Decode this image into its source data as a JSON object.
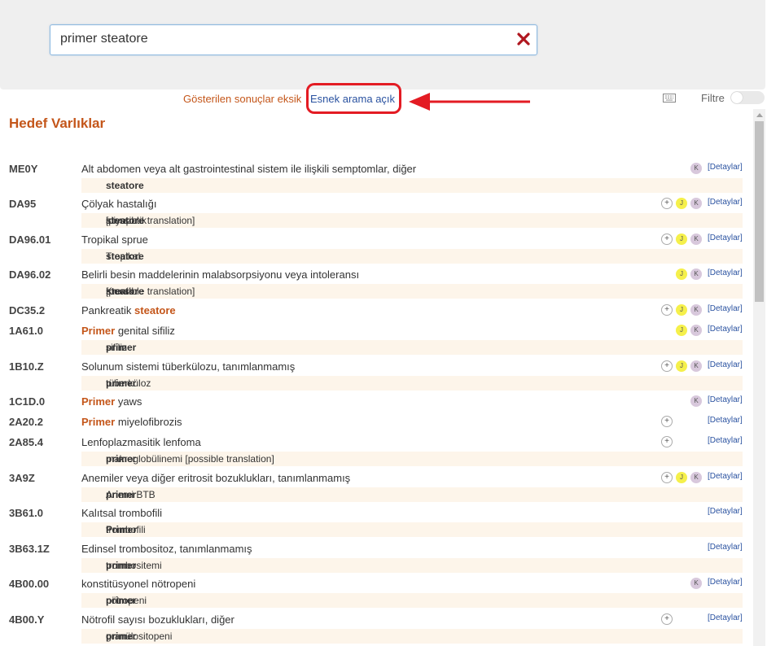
{
  "search": {
    "value": "primer steatore"
  },
  "info": {
    "results_message": "Gösterilen sonuçlar eksik",
    "flexible_search": "Esnek arama açık"
  },
  "filter_label": "Filtre",
  "section_title": "Hedef Varlıklar",
  "detail_label": "[Detaylar]",
  "badges": {
    "plus": "+",
    "j": "J",
    "k": "K"
  },
  "colors": {
    "accent": "#c4561a",
    "link": "#2a52a0",
    "annotation": "#e31b23"
  },
  "entries": [
    {
      "code": "ME0Y",
      "title": [
        {
          "t": "Alt abdomen veya alt gastrointestinal sistem ile ilişkili semptomlar, diğer"
        }
      ],
      "sub": [
        {
          "t": "steatore",
          "h": true
        }
      ],
      "badges": [
        "K"
      ]
    },
    {
      "code": "DA95",
      "title": [
        {
          "t": "Çölyak hastalığı"
        }
      ],
      "sub": [
        {
          "t": "idiyopatik "
        },
        {
          "t": "steatore",
          "h": true
        },
        {
          "t": " [possible translation]"
        }
      ],
      "badges": [
        "+",
        "J",
        "K"
      ]
    },
    {
      "code": "DA96.01",
      "title": [
        {
          "t": "Tropikal sprue"
        }
      ],
      "sub": [
        {
          "t": "Tropikal "
        },
        {
          "t": "steatore",
          "h": true
        }
      ],
      "badges": [
        "+",
        "J",
        "K"
      ]
    },
    {
      "code": "DA96.02",
      "title": [
        {
          "t": "Belirli besin maddelerinin malabsorpsiyonu veya intoleransı"
        }
      ],
      "sub": [
        {
          "t": "Kronik "
        },
        {
          "t": "steatore",
          "h": true
        },
        {
          "t": " [possible translation]"
        }
      ],
      "badges": [
        "J",
        "K"
      ]
    },
    {
      "code": "DC35.2",
      "title": [
        {
          "t": "Pankreatik "
        },
        {
          "t": "steatore",
          "h": true
        }
      ],
      "sub": null,
      "badges": [
        "+",
        "J",
        "K"
      ]
    },
    {
      "code": "1A61.0",
      "title": [
        {
          "t": "Primer",
          "h": true
        },
        {
          "t": " genital sifiliz"
        }
      ],
      "sub": [
        {
          "t": "primer",
          "h": true
        },
        {
          "t": " sifiliz"
        }
      ],
      "badges": [
        "J",
        "K"
      ]
    },
    {
      "code": "1B10.Z",
      "title": [
        {
          "t": "Solunum sistemi tüberkülozu, tanımlanmamış"
        }
      ],
      "sub": [
        {
          "t": "primer",
          "h": true
        },
        {
          "t": " tüberküloz"
        }
      ],
      "badges": [
        "+",
        "J",
        "K"
      ]
    },
    {
      "code": "1C1D.0",
      "title": [
        {
          "t": "Primer",
          "h": true
        },
        {
          "t": " yaws"
        }
      ],
      "sub": null,
      "badges": [
        "K"
      ]
    },
    {
      "code": "2A20.2",
      "title": [
        {
          "t": "Primer",
          "h": true
        },
        {
          "t": " miyelofibrozis"
        }
      ],
      "sub": null,
      "badges": [
        "+"
      ]
    },
    {
      "code": "2A85.4",
      "title": [
        {
          "t": "Lenfoplazmasitik lenfoma"
        }
      ],
      "sub": [
        {
          "t": "primer",
          "h": true
        },
        {
          "t": " makroglobülinemi [possible translation]"
        }
      ],
      "badges": [
        "+"
      ]
    },
    {
      "code": "3A9Z",
      "title": [
        {
          "t": "Anemiler veya diğer eritrosit bozuklukları, tanımlanmamış"
        }
      ],
      "sub": [
        {
          "t": "primer",
          "h": true
        },
        {
          "t": " Anemi BTB"
        }
      ],
      "badges": [
        "+",
        "J",
        "K"
      ]
    },
    {
      "code": "3B61.0",
      "title": [
        {
          "t": "Kalıtsal trombofili"
        }
      ],
      "sub": [
        {
          "t": "Primer",
          "h": true
        },
        {
          "t": " trombofili"
        }
      ],
      "badges": []
    },
    {
      "code": "3B63.1Z",
      "title": [
        {
          "t": "Edinsel trombositoz, tanımlanmamış"
        }
      ],
      "sub": [
        {
          "t": "primer",
          "h": true
        },
        {
          "t": " trombositemi"
        }
      ],
      "badges": []
    },
    {
      "code": "4B00.00",
      "title": [
        {
          "t": "konstitüsyonel nötropeni"
        }
      ],
      "sub": [
        {
          "t": "primer",
          "h": true
        },
        {
          "t": " nötropeni"
        }
      ],
      "badges": [
        "K"
      ]
    },
    {
      "code": "4B00.Y",
      "title": [
        {
          "t": "Nötrofil sayısı bozuklukları, diğer"
        }
      ],
      "sub": [
        {
          "t": "primer",
          "h": true
        },
        {
          "t": " granülositopeni"
        }
      ],
      "badges": [
        "+"
      ]
    }
  ]
}
